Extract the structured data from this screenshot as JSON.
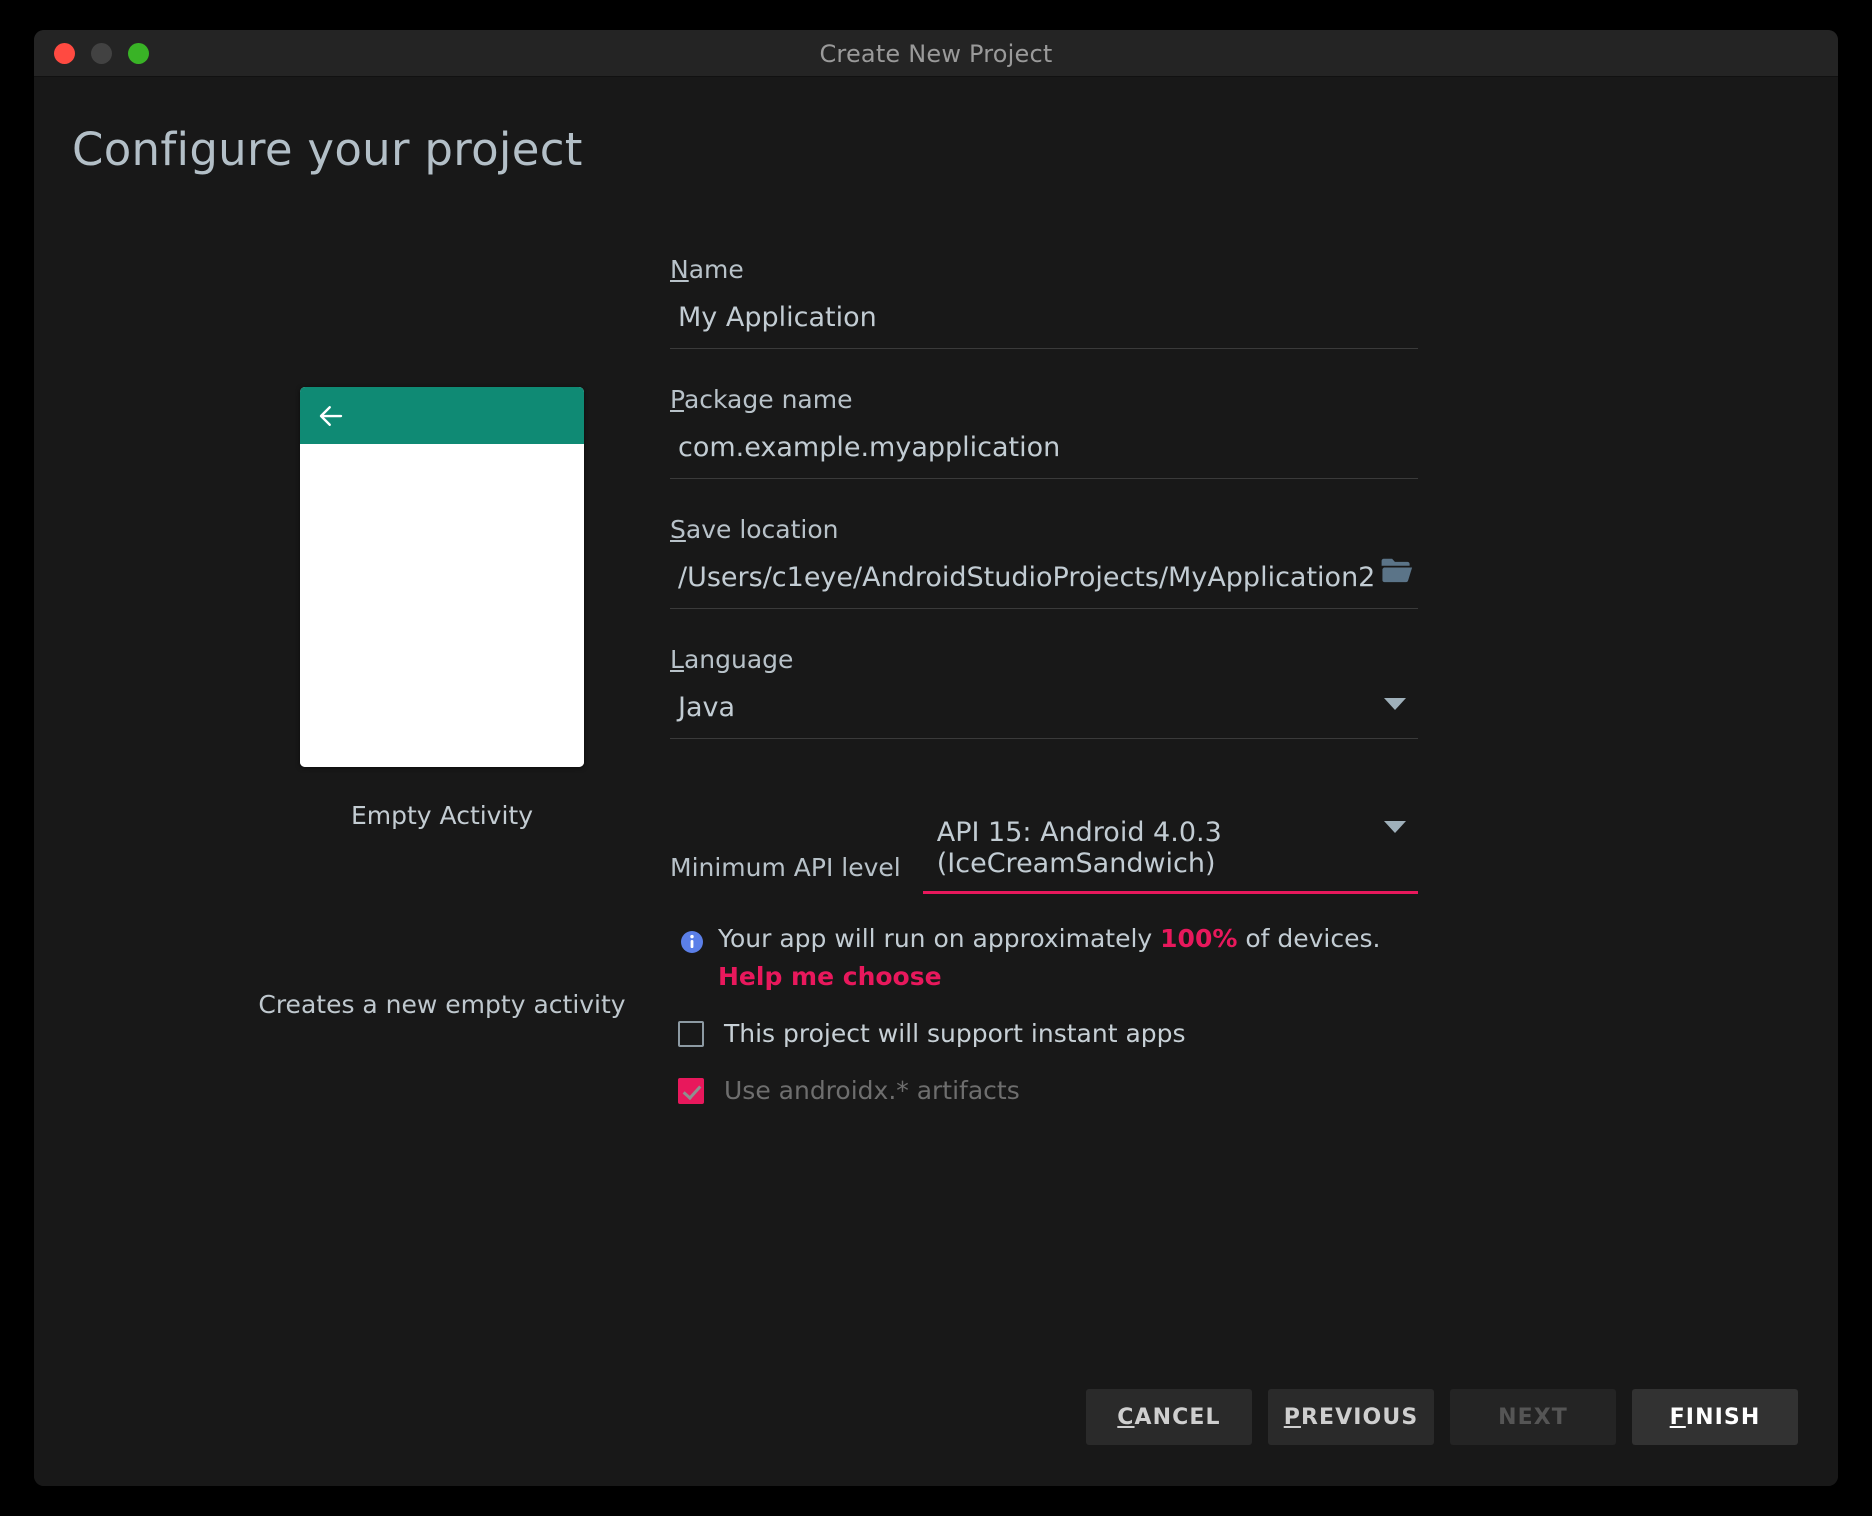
{
  "window": {
    "title": "Create New Project",
    "traffic_lights": [
      "close-button",
      "minimize-button",
      "maximize-button"
    ]
  },
  "page": {
    "heading": "Configure your project"
  },
  "preview": {
    "back_icon": "back-arrow-icon",
    "template_name": "Empty Activity",
    "template_description": "Creates a new empty activity",
    "appbar_color": "#0f8a74"
  },
  "form": {
    "name": {
      "label_mnemonic": "N",
      "label_rest": "ame",
      "value": "My Application"
    },
    "package_name": {
      "label_mnemonic": "P",
      "label_rest": "ackage name",
      "value": "com.example.myapplication"
    },
    "save_location": {
      "label_mnemonic": "S",
      "label_rest": "ave location",
      "value": "/Users/c1eye/AndroidStudioProjects/MyApplication2",
      "browse_icon": "folder-icon"
    },
    "language": {
      "label_mnemonic": "L",
      "label_rest": "anguage",
      "value": "Java",
      "caret_icon": "chevron-down-icon"
    },
    "min_api": {
      "label": "Minimum API level",
      "value": "API 15: Android 4.0.3 (IceCreamSandwich)",
      "caret_icon": "chevron-down-icon",
      "focus_color": "#e8185c"
    },
    "devices_info": {
      "icon": "info-icon",
      "text_before": "Your app will run on approximately ",
      "percent": "100%",
      "text_after": " of devices.",
      "help_link": "Help me choose"
    },
    "instant_apps": {
      "label": "This project will support instant apps",
      "checked": false
    },
    "androidx": {
      "label": "Use androidx.* artifacts",
      "checked": true,
      "disabled": true
    }
  },
  "footer": {
    "cancel": {
      "mnemonic": "C",
      "rest": "ANCEL"
    },
    "previous": {
      "mnemonic": "P",
      "rest": "REVIOUS"
    },
    "next": {
      "label": "NEXT",
      "disabled": true
    },
    "finish": {
      "mnemonic": "F",
      "rest": "INISH",
      "default": true
    }
  }
}
